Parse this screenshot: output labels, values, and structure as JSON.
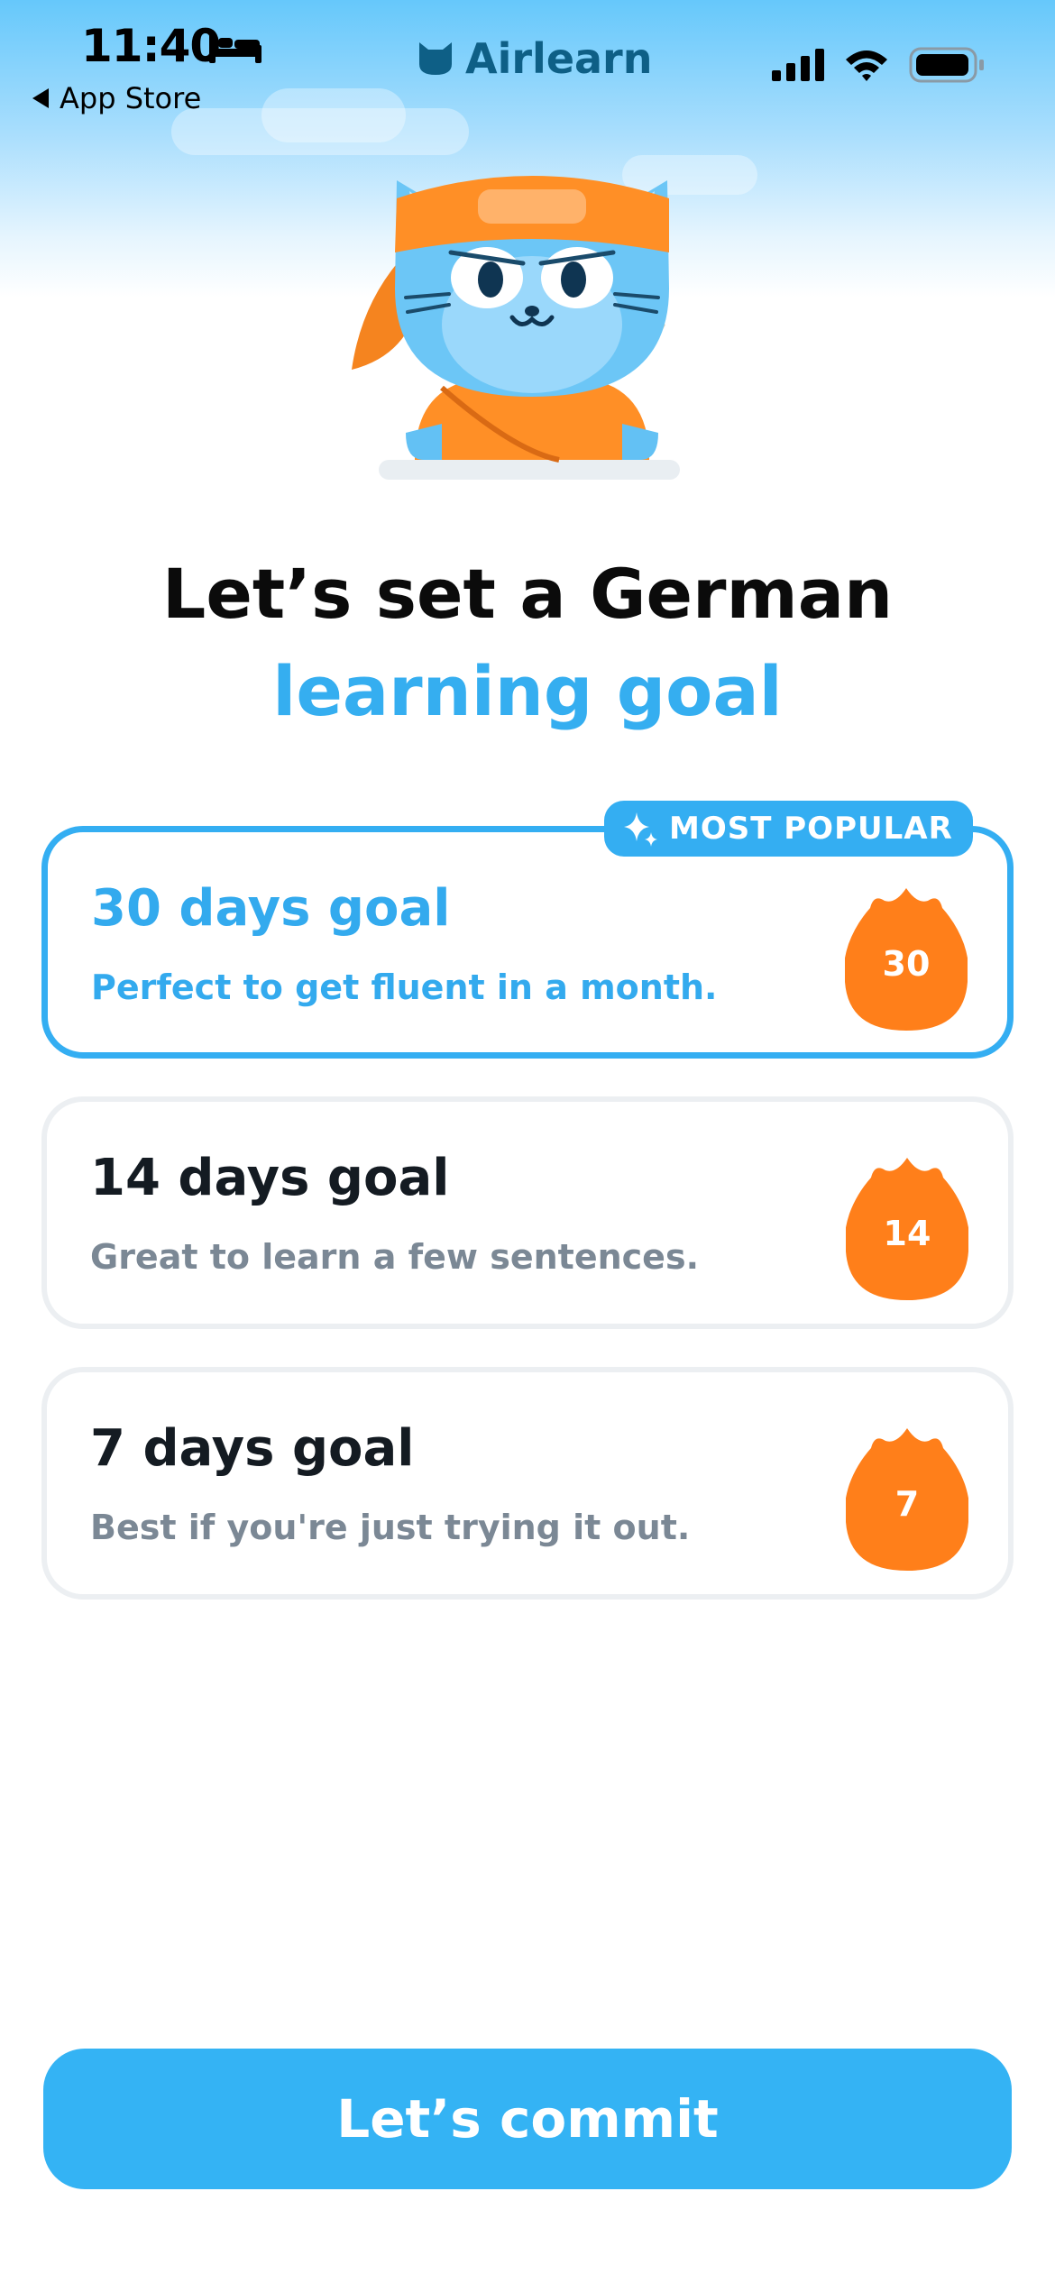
{
  "status_bar": {
    "time": "11:40",
    "back_label": "App Store",
    "icons": [
      "bed-icon",
      "signal-icon",
      "wifi-icon",
      "battery-icon"
    ]
  },
  "brand": {
    "name": "Airlearn",
    "icon": "cat-head-icon"
  },
  "mascot": {
    "icon": "ninja-cat-mascot"
  },
  "heading": {
    "line1": "Let’s set a German",
    "line2": "learning goal"
  },
  "badge": {
    "label": "MOST POPULAR",
    "icon": "sparkle-icon"
  },
  "goals": [
    {
      "title": "30 days goal",
      "description": "Perfect to get fluent in a month.",
      "days": "30",
      "selected": true
    },
    {
      "title": "14 days goal",
      "description": "Great to learn a few sentences.",
      "days": "14",
      "selected": false
    },
    {
      "title": "7 days goal",
      "description": "Best if you're just trying it out.",
      "days": "7",
      "selected": false
    }
  ],
  "commit_button": {
    "label": "Let’s commit"
  },
  "colors": {
    "accent": "#34aef2",
    "flame": "#ff7f1a",
    "title_dark": "#141b22",
    "muted": "#7b8895"
  }
}
